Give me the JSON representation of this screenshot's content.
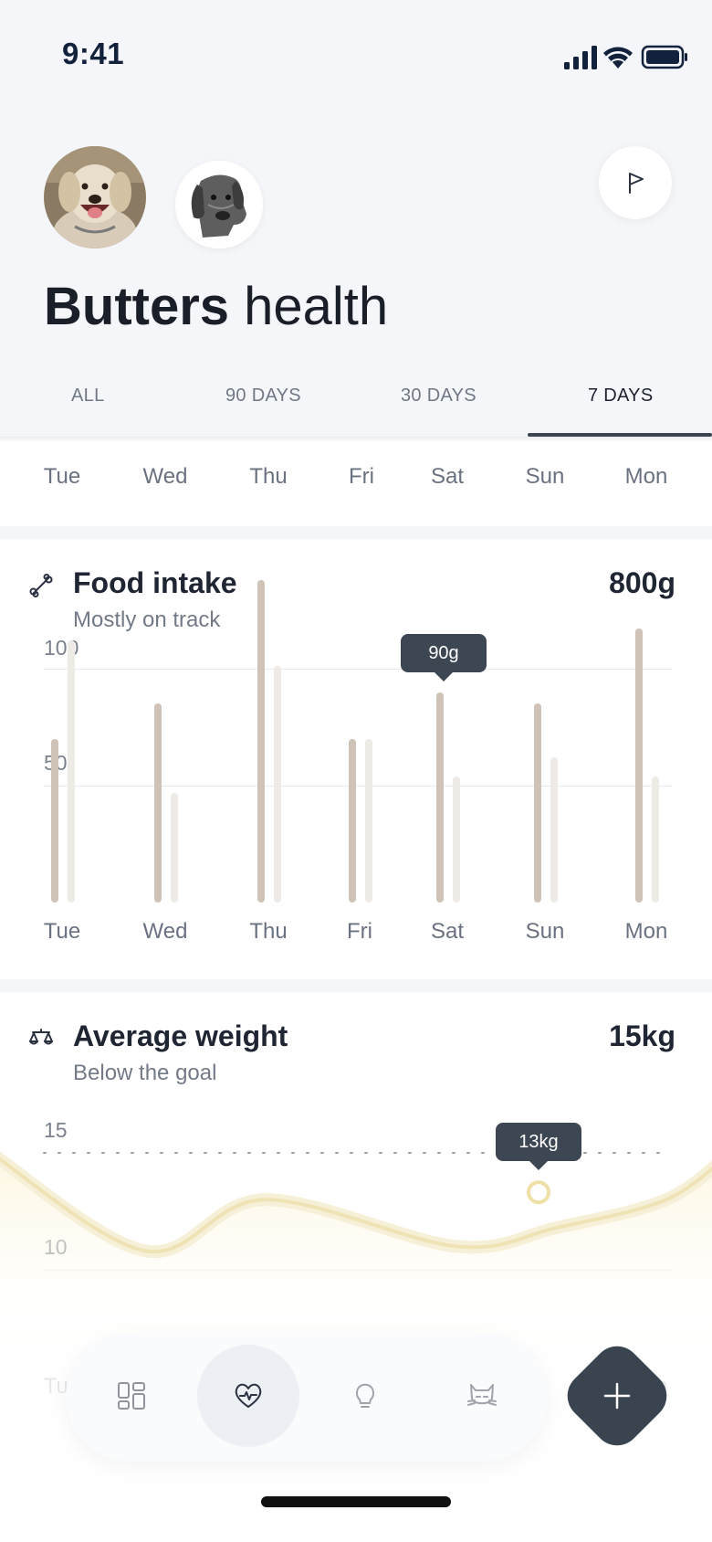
{
  "status": {
    "time": "9:41"
  },
  "profile": {
    "title_bold": "Butters",
    "title_rest": " health"
  },
  "tabs": [
    {
      "label": "ALL",
      "active": false
    },
    {
      "label": "90 DAYS",
      "active": false
    },
    {
      "label": "30 DAYS",
      "active": false
    },
    {
      "label": "7 DAYS",
      "active": true
    }
  ],
  "days": [
    "Tue",
    "Wed",
    "Thu",
    "Fri",
    "Sat",
    "Sun",
    "Mon"
  ],
  "food": {
    "title": "Food intake",
    "subtitle": "Mostly on track",
    "value": "800g",
    "tooltip": "90g",
    "y_ticks": [
      "100",
      "50"
    ]
  },
  "weight": {
    "title": "Average weight",
    "subtitle": "Below the goal",
    "value": "15kg",
    "tooltip": "13kg",
    "y_ticks": [
      "15",
      "10"
    ]
  },
  "colors": {
    "bar_primary": "#cfc3b7",
    "bar_secondary": "#eeeae6",
    "weight_line": "#efe3b5",
    "accent_dark": "#3a4450"
  },
  "chart_data": [
    {
      "type": "bar",
      "title": "Food intake",
      "categories": [
        "Tue",
        "Wed",
        "Thu",
        "Fri",
        "Sat",
        "Sun",
        "Mon"
      ],
      "series": [
        {
          "values": [
            70,
            85,
            138,
            70,
            90,
            85,
            117
          ]
        },
        {
          "values": [
            112,
            47,
            101,
            70,
            54,
            62,
            54
          ]
        }
      ],
      "ylim": [
        0,
        140
      ],
      "y_ticks": [
        50,
        100
      ],
      "highlight": {
        "category": "Sat",
        "label": "90g"
      }
    },
    {
      "type": "line",
      "title": "Average weight",
      "x": [
        "Tue",
        "Wed",
        "Thu",
        "Fri",
        "Sat",
        "Sun",
        "Mon"
      ],
      "series": [
        {
          "values": [
            15,
            10.8,
            13,
            11,
            11.8,
            13,
            15
          ]
        }
      ],
      "ylim": [
        7,
        17
      ],
      "y_ticks": [
        10,
        15
      ],
      "goal": 15,
      "highlight": {
        "category": "Sun",
        "label": "13kg"
      }
    }
  ],
  "nav": {
    "items": [
      "dashboard-icon",
      "heart-icon",
      "lightbulb-icon",
      "cat-icon"
    ],
    "active": "heart-icon"
  }
}
